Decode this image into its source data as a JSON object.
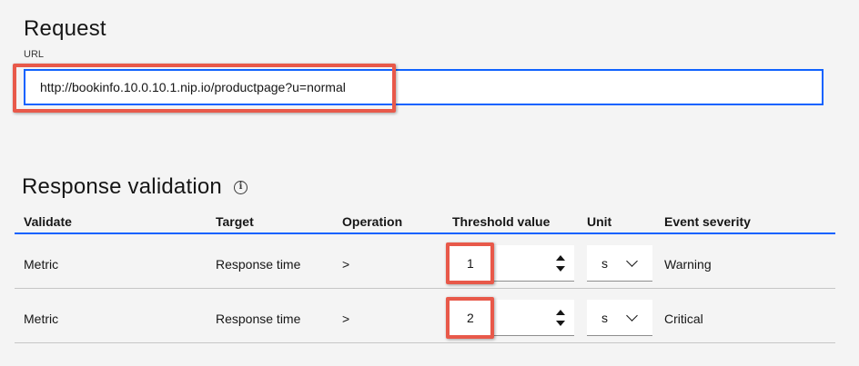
{
  "request": {
    "title": "Request",
    "url_label": "URL",
    "url_value": "http://bookinfo.10.0.10.1.nip.io/productpage?u=normal"
  },
  "response_validation": {
    "title": "Response validation",
    "info_icon": "info-icon",
    "columns": [
      "Validate",
      "Target",
      "Operation",
      "Threshold value",
      "Unit",
      "Event severity"
    ],
    "rows": [
      {
        "validate": "Metric",
        "target": "Response time",
        "operation": ">",
        "threshold": "1",
        "unit": "s",
        "severity": "Warning"
      },
      {
        "validate": "Metric",
        "target": "Response time",
        "operation": ">",
        "threshold": "2",
        "unit": "s",
        "severity": "Critical"
      }
    ]
  },
  "colors": {
    "accent": "#0f62fe",
    "highlight": "#e8594a",
    "background": "#f4f4f4"
  }
}
